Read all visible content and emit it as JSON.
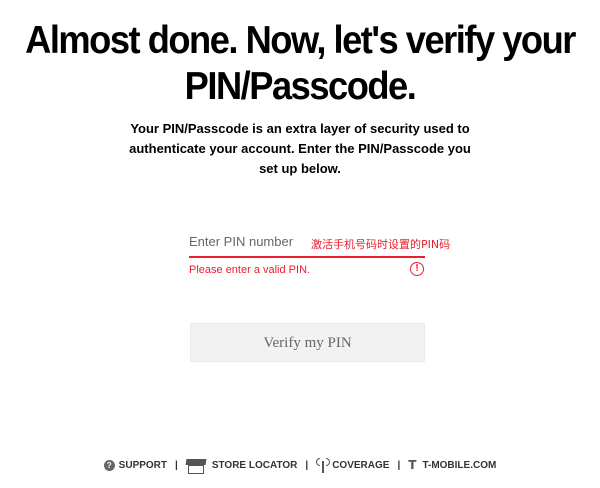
{
  "heading": {
    "line1": "Almost done. Now, let's verify your",
    "line2": "PIN/Passcode."
  },
  "intro": "Your PIN/Passcode is an extra layer of security used to authenticate your account. Enter the PIN/Passcode you set up below.",
  "pin_field": {
    "placeholder": "Enter PIN number",
    "value": "",
    "hint": "激活手机号码时设置的PIN码"
  },
  "error": {
    "message": "Please enter a valid PIN.",
    "icon_glyph": "!",
    "icon": "error-circle-icon",
    "color": "#e8202e"
  },
  "verify_button": {
    "label": "Verify my PIN"
  },
  "footer": {
    "support": "SUPPORT",
    "store_locator": "STORE LOCATOR",
    "coverage": "COVERAGE",
    "tmobile": "T-MOBILE.COM",
    "separator": "|",
    "help_glyph": "?",
    "tmobile_glyph": "T"
  }
}
